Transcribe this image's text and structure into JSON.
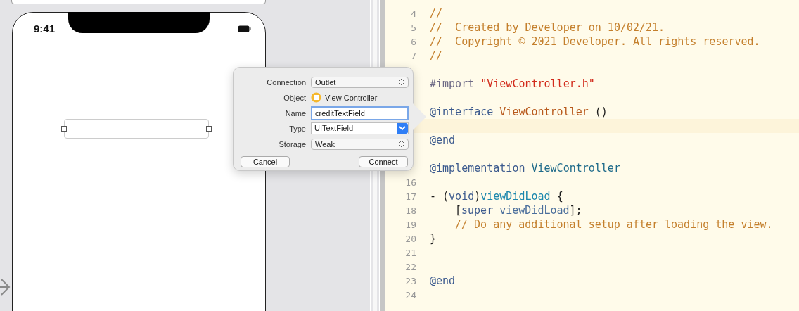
{
  "canvas": {
    "phone": {
      "time": "9:41"
    }
  },
  "popover": {
    "rows": [
      {
        "label": "Connection",
        "kind": "popup",
        "value": "Outlet"
      },
      {
        "label": "Object",
        "kind": "object",
        "value": "View Controller"
      },
      {
        "label": "Name",
        "kind": "text",
        "value": "creditTextField",
        "focused": true
      },
      {
        "label": "Type",
        "kind": "combo",
        "value": "UITextField"
      },
      {
        "label": "Storage",
        "kind": "popup",
        "value": "Weak"
      }
    ],
    "buttons": [
      "Cancel",
      "Connect"
    ]
  },
  "editor": {
    "lines": [
      {
        "number": "4",
        "current": false,
        "tokens": [
          {
            "kind": "comment",
            "text": "//"
          }
        ]
      },
      {
        "number": "5",
        "current": false,
        "tokens": [
          {
            "kind": "comment",
            "text": "//  Created by Developer on 10/02/21."
          }
        ]
      },
      {
        "number": "6",
        "current": false,
        "tokens": [
          {
            "kind": "comment",
            "text": "//  Copyright © 2021 Developer. All rights reserved."
          }
        ]
      },
      {
        "number": "7",
        "current": false,
        "tokens": [
          {
            "kind": "comment",
            "text": "//"
          }
        ]
      },
      {
        "current": false
      },
      {
        "current": false,
        "tokens": [
          {
            "kind": "preproc",
            "text": "#import "
          },
          {
            "kind": "string",
            "text": "\"ViewController.h\""
          }
        ]
      },
      {
        "current": false
      },
      {
        "current": false,
        "tokens": [
          {
            "kind": "keyword",
            "text": "@interface "
          },
          {
            "kind": "class-decl",
            "text": "ViewController "
          },
          {
            "kind": "plain",
            "text": "()"
          }
        ]
      },
      {
        "current": true
      },
      {
        "current": false,
        "tokens": [
          {
            "kind": "keyword",
            "text": "@end"
          }
        ]
      },
      {
        "current": false
      },
      {
        "current": false,
        "tokens": [
          {
            "kind": "keyword",
            "text": "@implementation "
          },
          {
            "kind": "class-ref",
            "text": "ViewController"
          }
        ]
      },
      {
        "number": "16",
        "current": false
      },
      {
        "number": "17",
        "current": false,
        "tokens": [
          {
            "kind": "plain",
            "text": "- ("
          },
          {
            "kind": "keyword",
            "text": "void"
          },
          {
            "kind": "plain",
            "text": ")"
          },
          {
            "kind": "func-decl",
            "text": "viewDidLoad "
          },
          {
            "kind": "plain",
            "text": "{"
          }
        ]
      },
      {
        "number": "18",
        "current": false,
        "indent": true,
        "tokens": [
          {
            "kind": "plain",
            "text": "["
          },
          {
            "kind": "keyword",
            "text": "super "
          },
          {
            "kind": "method",
            "text": "viewDidLoad"
          },
          {
            "kind": "plain",
            "text": "];"
          }
        ]
      },
      {
        "number": "19",
        "current": false,
        "indent": true,
        "tokens": [
          {
            "kind": "comment",
            "text": "// Do any additional setup after loading the view."
          }
        ]
      },
      {
        "number": "20",
        "current": false,
        "tokens": [
          {
            "kind": "plain",
            "text": "}"
          }
        ]
      },
      {
        "number": "21",
        "current": false
      },
      {
        "number": "22",
        "current": false
      },
      {
        "number": "23",
        "current": false,
        "tokens": [
          {
            "kind": "keyword",
            "text": "@end"
          }
        ]
      },
      {
        "number": "24",
        "current": false
      }
    ]
  }
}
